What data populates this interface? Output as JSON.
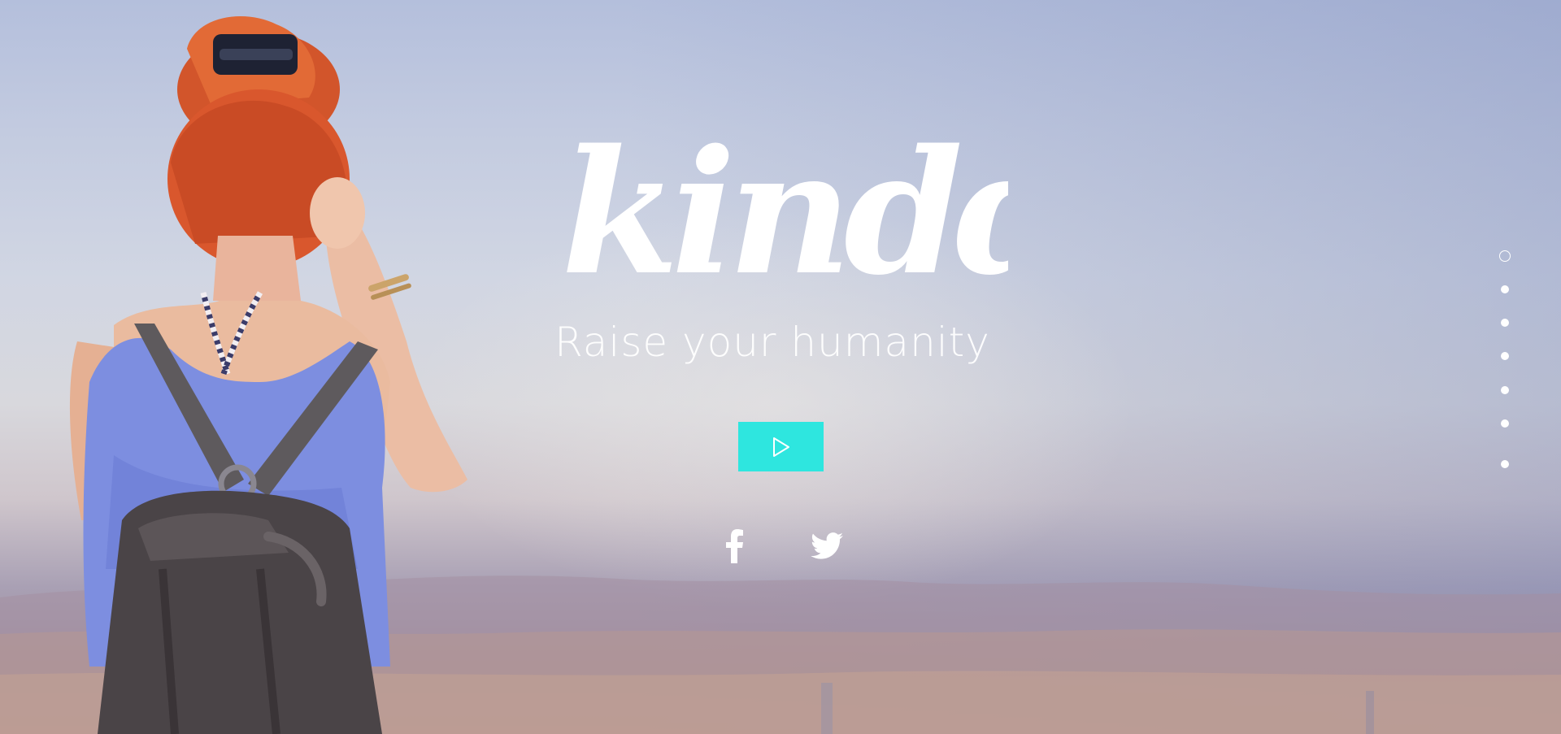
{
  "brand": {
    "logo_text": "kindd",
    "tagline": "Raise your humanity"
  },
  "hero": {
    "play_button_icon": "play-icon",
    "accent_color": "#2ee6df"
  },
  "social": [
    {
      "network": "facebook",
      "icon": "facebook-icon"
    },
    {
      "network": "twitter",
      "icon": "twitter-icon"
    }
  ],
  "section_nav": {
    "total": 7,
    "active_index": 0
  }
}
